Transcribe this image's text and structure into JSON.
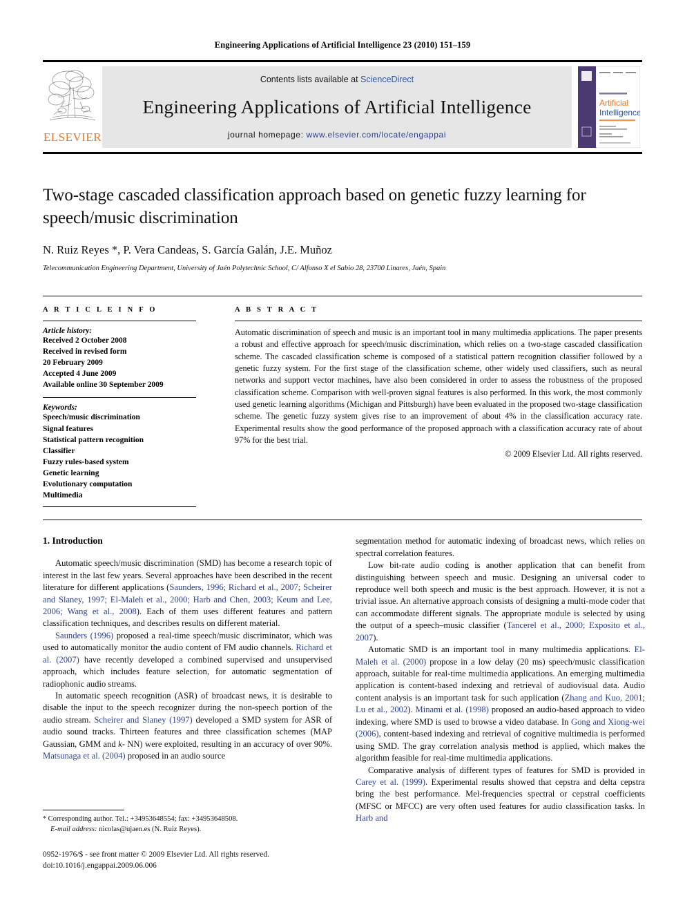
{
  "running_head": "Engineering Applications of Artificial Intelligence 23 (2010) 151–159",
  "masthead": {
    "publisher_name": "ELSEVIER",
    "contents_prefix": "Contents lists available at ",
    "contents_link": "ScienceDirect",
    "journal_title": "Engineering Applications of Artificial Intelligence",
    "homepage_label": "journal homepage: ",
    "homepage_url": "www.elsevier.com/locate/engappai",
    "cover": {
      "line1": "Engineering Applications of",
      "line2": "Artificial",
      "line3": "Intelligence"
    },
    "colors": {
      "elsevier_orange": "#E87722",
      "link_blue": "#2b53a4",
      "banner_gray": "#e6e6e6",
      "cover_purple": "#4b3a72"
    }
  },
  "article": {
    "title": "Two-stage cascaded classification approach based on genetic fuzzy learning for speech/music discrimination",
    "authors": "N. Ruiz Reyes *, P. Vera Candeas, S. García Galán, J.E. Muñoz",
    "affiliation": "Telecommunication Engineering Department, University of Jaén Polytechnic School, C/ Alfonso X el Sabio 28, 23700 Linares, Jaén, Spain"
  },
  "info": {
    "heading": "A R T I C L E   I N F O",
    "history_label": "Article history:",
    "history": [
      "Received 2 October 2008",
      "Received in revised form",
      "20 February 2009",
      "Accepted 4 June 2009",
      "Available online 30 September 2009"
    ],
    "keywords_label": "Keywords:",
    "keywords": [
      "Speech/music discrimination",
      "Signal features",
      "Statistical pattern recognition",
      "Classifier",
      "Fuzzy rules-based system",
      "Genetic learning",
      "Evolutionary computation",
      "Multimedia"
    ]
  },
  "abstract": {
    "heading": "A B S T R A C T",
    "text": "Automatic discrimination of speech and music is an important tool in many multimedia applications. The paper presents a robust and effective approach for speech/music discrimination, which relies on a two-stage cascaded classification scheme. The cascaded classification scheme is composed of a statistical pattern recognition classifier followed by a genetic fuzzy system. For the first stage of the classification scheme, other widely used classifiers, such as neural networks and support vector machines, have also been considered in order to assess the robustness of the proposed classification scheme. Comparison with well-proven signal features is also performed. In this work, the most commonly used genetic learning algorithms (Michigan and Pittsburgh) have been evaluated in the proposed two-stage classification scheme. The genetic fuzzy system gives rise to an improvement of about 4% in the classification accuracy rate. Experimental results show the good performance of the proposed approach with a classification accuracy rate of about 97% for the best trial.",
    "copyright": "© 2009 Elsevier Ltd. All rights reserved."
  },
  "introduction": {
    "section_number": "1.",
    "section_title": "Introduction",
    "left_paragraphs": [
      {
        "segments": [
          {
            "t": "Automatic speech/music discrimination (SMD) has become a research topic of interest in the last few years. Several approaches have been described in the recent literature for different applications (",
            "k": "plain"
          },
          {
            "t": "Saunders, 1996; Richard et al., 2007; Scheirer and Slaney, 1997; El-Maleh et al., 2000; Harb and Chen, 2003; Keum and Lee, 2006; Wang et al., 2008",
            "k": "cite"
          },
          {
            "t": "). Each of them uses different features and pattern classification techniques, and describes results on different material.",
            "k": "plain"
          }
        ]
      },
      {
        "segments": [
          {
            "t": "Saunders (1996)",
            "k": "cite"
          },
          {
            "t": " proposed a real-time speech/music discriminator, which was used to automatically monitor the audio content of FM audio channels. ",
            "k": "plain"
          },
          {
            "t": "Richard et al. (2007)",
            "k": "cite"
          },
          {
            "t": " have recently developed a combined supervised and unsupervised approach, which includes feature selection, for automatic segmentation of radiophonic audio streams.",
            "k": "plain"
          }
        ]
      },
      {
        "segments": [
          {
            "t": "In automatic speech recognition (ASR) of broadcast news, it is desirable to disable the input to the speech recognizer during the non-speech portion of the audio stream. ",
            "k": "plain"
          },
          {
            "t": "Scheirer and Slaney (1997)",
            "k": "cite"
          },
          {
            "t": " developed a SMD system for ASR of audio sound tracks. Thirteen features and three classification schemes (MAP Gaussian, GMM and ",
            "k": "plain"
          },
          {
            "t": "k",
            "k": "italic"
          },
          {
            "t": "- NN) were exploited, resulting in an accuracy of over 90%. ",
            "k": "plain"
          },
          {
            "t": "Matsunaga et al. (2004)",
            "k": "cite"
          },
          {
            "t": " proposed in an audio source",
            "k": "plain"
          }
        ]
      }
    ],
    "right_paragraphs": [
      {
        "segments": [
          {
            "t": "segmentation method for automatic indexing of broadcast news, which relies on spectral correlation features.",
            "k": "plain"
          }
        ],
        "indent": false
      },
      {
        "segments": [
          {
            "t": "Low bit-rate audio coding is another application that can benefit from distinguishing between speech and music. Designing an universal coder to reproduce well both speech and music is the best approach. However, it is not a trivial issue. An alternative approach consists of designing a multi-mode coder that can accommodate different signals. The appropriate module is selected by using the output of a speech–music classifier (",
            "k": "plain"
          },
          {
            "t": "Tancerel et al., 2000; Exposito et al., 2007",
            "k": "cite"
          },
          {
            "t": ").",
            "k": "plain"
          }
        ],
        "indent": true
      },
      {
        "segments": [
          {
            "t": "Automatic SMD is an important tool in many multimedia applications. ",
            "k": "plain"
          },
          {
            "t": "El-Maleh et al. (2000)",
            "k": "cite"
          },
          {
            "t": " propose in a low delay (20 ms) speech/music classification approach, suitable for real-time multimedia applications. An emerging multimedia application is content-based indexing and retrieval of audiovisual data. Audio content analysis is an important task for such application (",
            "k": "plain"
          },
          {
            "t": "Zhang and Kuo, 2001",
            "k": "cite"
          },
          {
            "t": "; ",
            "k": "plain"
          },
          {
            "t": "Lu et al., 2002",
            "k": "cite"
          },
          {
            "t": "). ",
            "k": "plain"
          },
          {
            "t": "Minami et al. (1998)",
            "k": "cite"
          },
          {
            "t": " proposed an audio-based approach to video indexing, where SMD is used to browse a video database. In ",
            "k": "plain"
          },
          {
            "t": "Gong and Xiong-wei (2006)",
            "k": "cite"
          },
          {
            "t": ", content-based indexing and retrieval of cognitive multimedia is performed using SMD. The gray correlation analysis method is applied, which makes the algorithm feasible for real-time multimedia applications.",
            "k": "plain"
          }
        ],
        "indent": true
      },
      {
        "segments": [
          {
            "t": "Comparative analysis of different types of features for SMD is provided in ",
            "k": "plain"
          },
          {
            "t": "Carey et al. (1999)",
            "k": "cite"
          },
          {
            "t": ". Experimental results showed that cepstra and delta cepstra bring the best performance. Mel-frequencies spectral or cepstral coefficients (MFSC or MFCC) are very often used features for audio classification tasks. In ",
            "k": "plain"
          },
          {
            "t": "Harb and",
            "k": "cite"
          }
        ],
        "indent": true
      }
    ]
  },
  "footnotes": {
    "corresponding": "Corresponding author. Tel.: +34953648554; fax: +34953648508.",
    "email_label": "E-mail address:",
    "email_value": "nicolas@ujaen.es (N. Ruiz Reyes).",
    "imprint_line1": "0952-1976/$ - see front matter © 2009 Elsevier Ltd. All rights reserved.",
    "imprint_line2": "doi:10.1016/j.engappai.2009.06.006"
  }
}
